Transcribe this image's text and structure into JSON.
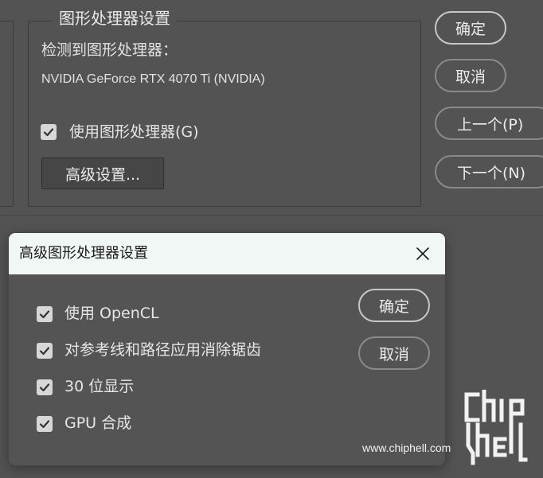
{
  "panel": {
    "group_title": "图形处理器设置",
    "detected_label": "检测到图形处理器：",
    "gpu_name": "NVIDIA GeForce RTX 4070 Ti (NVIDIA)",
    "use_gpu_label": "使用图形处理器(G)",
    "use_gpu_checked": true,
    "advanced_button": "高级设置..."
  },
  "side_buttons": {
    "ok": "确定",
    "cancel": "取消",
    "prev": "上一个(P)",
    "next": "下一个(N)"
  },
  "dialog": {
    "title": "高级图形处理器设置",
    "options": [
      {
        "label": "使用 OpenCL",
        "checked": true
      },
      {
        "label": "对参考线和路径应用消除锯齿",
        "checked": true
      },
      {
        "label": "30 位显示",
        "checked": true
      },
      {
        "label": "GPU 合成",
        "checked": true
      }
    ],
    "ok": "确定",
    "cancel": "取消"
  },
  "watermark": {
    "url": "www.chiphell.com",
    "logo": "chip hell"
  },
  "icons": {
    "check": "check-icon",
    "close": "close-icon"
  },
  "colors": {
    "background": "#535353",
    "titlebar": "#f0f7f5",
    "checkbox": "#d7d7d7"
  }
}
